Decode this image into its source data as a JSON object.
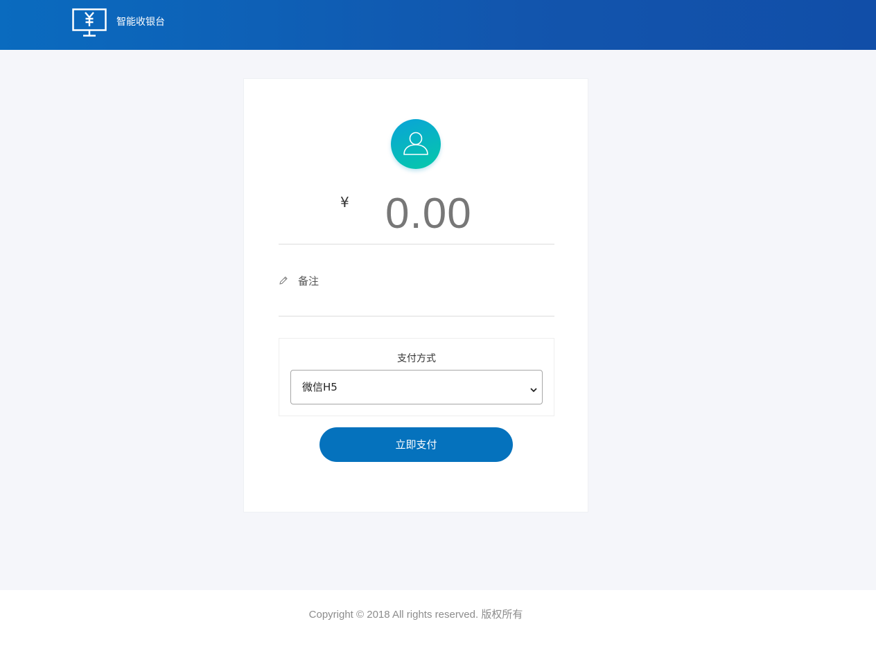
{
  "header": {
    "brand": "智能收银台",
    "icon": "cashier-monitor-icon",
    "background_color": "#0a6bbf"
  },
  "payment": {
    "avatar_icon": "user-icon",
    "currency": "¥",
    "amount": "0.00",
    "remark_icon": "pencil-icon",
    "remark_label": "备注",
    "method_title": "支付方式",
    "method_selected": "微信H5",
    "submit_label": "立即支付",
    "accent_color": "#0572bd"
  },
  "footer": {
    "copyright": "Copyright © 2018 All rights reserved. 版权所有"
  }
}
